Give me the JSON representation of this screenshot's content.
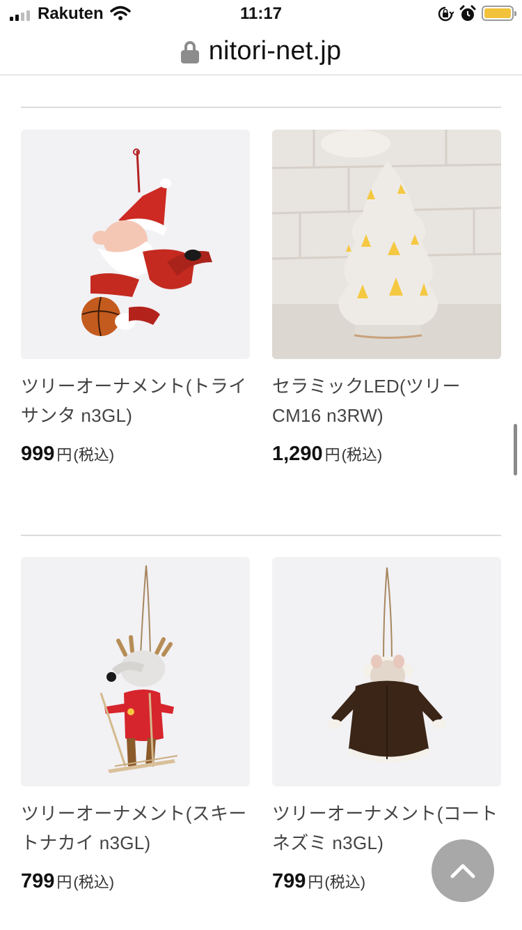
{
  "status": {
    "carrier": "Rakuten",
    "time": "11:17",
    "battery_color": "#f2c23a"
  },
  "browser": {
    "url": "nitori-net.jp"
  },
  "icons": {
    "padlock": "lock-icon",
    "back_to_top": "chevron-up-icon"
  },
  "products": [
    {
      "name": "ツリーオーナメント(トライサンタ n3GL)",
      "price": "999",
      "unit": "円",
      "tax": "(税込)",
      "image": "santa-ornament"
    },
    {
      "name": "セラミックLED(ツリー CM16 n3RW)",
      "price": "1,290",
      "unit": "円",
      "tax": "(税込)",
      "image": "ceramic-led-tree"
    },
    {
      "name": "ツリーオーナメント(スキートナカイ n3GL)",
      "price": "799",
      "unit": "円",
      "tax": "(税込)",
      "image": "ski-reindeer-ornament"
    },
    {
      "name": "ツリーオーナメント(コートネズミ n3GL)",
      "price": "799",
      "unit": "円",
      "tax": "(税込)",
      "image": "coat-mouse-ornament"
    }
  ]
}
